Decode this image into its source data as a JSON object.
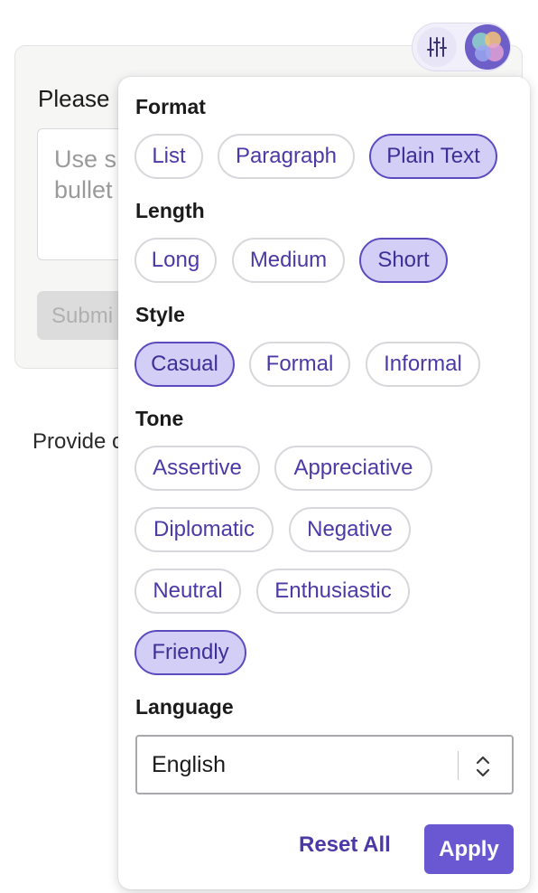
{
  "background": {
    "prompt_text": "Please",
    "textarea_placeholder": "Use s\nbullet",
    "submit_label": "Submi",
    "provide_text": "Provide c"
  },
  "header": {
    "settings_icon": "sliders-icon",
    "avatar_icon": "assistant-avatar-icon"
  },
  "popover": {
    "format": {
      "title": "Format",
      "options": [
        {
          "label": "List",
          "selected": false
        },
        {
          "label": "Paragraph",
          "selected": false
        },
        {
          "label": "Plain Text",
          "selected": true
        }
      ]
    },
    "length": {
      "title": "Length",
      "options": [
        {
          "label": "Long",
          "selected": false
        },
        {
          "label": "Medium",
          "selected": false
        },
        {
          "label": "Short",
          "selected": true
        }
      ]
    },
    "style": {
      "title": "Style",
      "options": [
        {
          "label": "Casual",
          "selected": true
        },
        {
          "label": "Formal",
          "selected": false
        },
        {
          "label": "Informal",
          "selected": false
        }
      ]
    },
    "tone": {
      "title": "Tone",
      "options": [
        {
          "label": "Assertive",
          "selected": false
        },
        {
          "label": "Appreciative",
          "selected": false
        },
        {
          "label": "Diplomatic",
          "selected": false
        },
        {
          "label": "Negative",
          "selected": false
        },
        {
          "label": "Neutral",
          "selected": false
        },
        {
          "label": "Enthusiastic",
          "selected": false
        },
        {
          "label": "Friendly",
          "selected": true
        }
      ]
    },
    "language": {
      "title": "Language",
      "selected": "English"
    },
    "reset_label": "Reset All",
    "apply_label": "Apply"
  },
  "colors": {
    "accent": "#6a57d2",
    "chip_text": "#4b3aa6",
    "chip_selected_bg": "#d3cef6"
  }
}
